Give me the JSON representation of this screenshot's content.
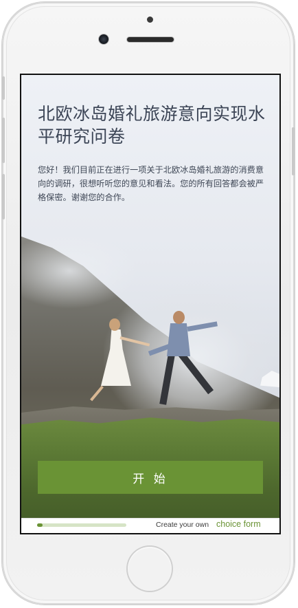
{
  "survey": {
    "title": "北欧冰岛婚礼旅游意向实现水平研究问卷",
    "intro": "您好！我们目前正在进行一项关于北欧冰岛婚礼旅游的消费意向的调研，很想听听您的意见和看法。您的所有回答都会被严格保密。谢谢您的合作。",
    "start_label": "开 始"
  },
  "footer": {
    "progress": 0.06,
    "create_text": "Create your own",
    "brand": "choice form"
  },
  "colors": {
    "accent": "#6a9335",
    "title_text": "#3c4556",
    "progress_track": "#d6e4c6"
  },
  "icons": {
    "home_button": "home-button",
    "camera": "front-camera",
    "speaker": "earpiece-speaker"
  }
}
